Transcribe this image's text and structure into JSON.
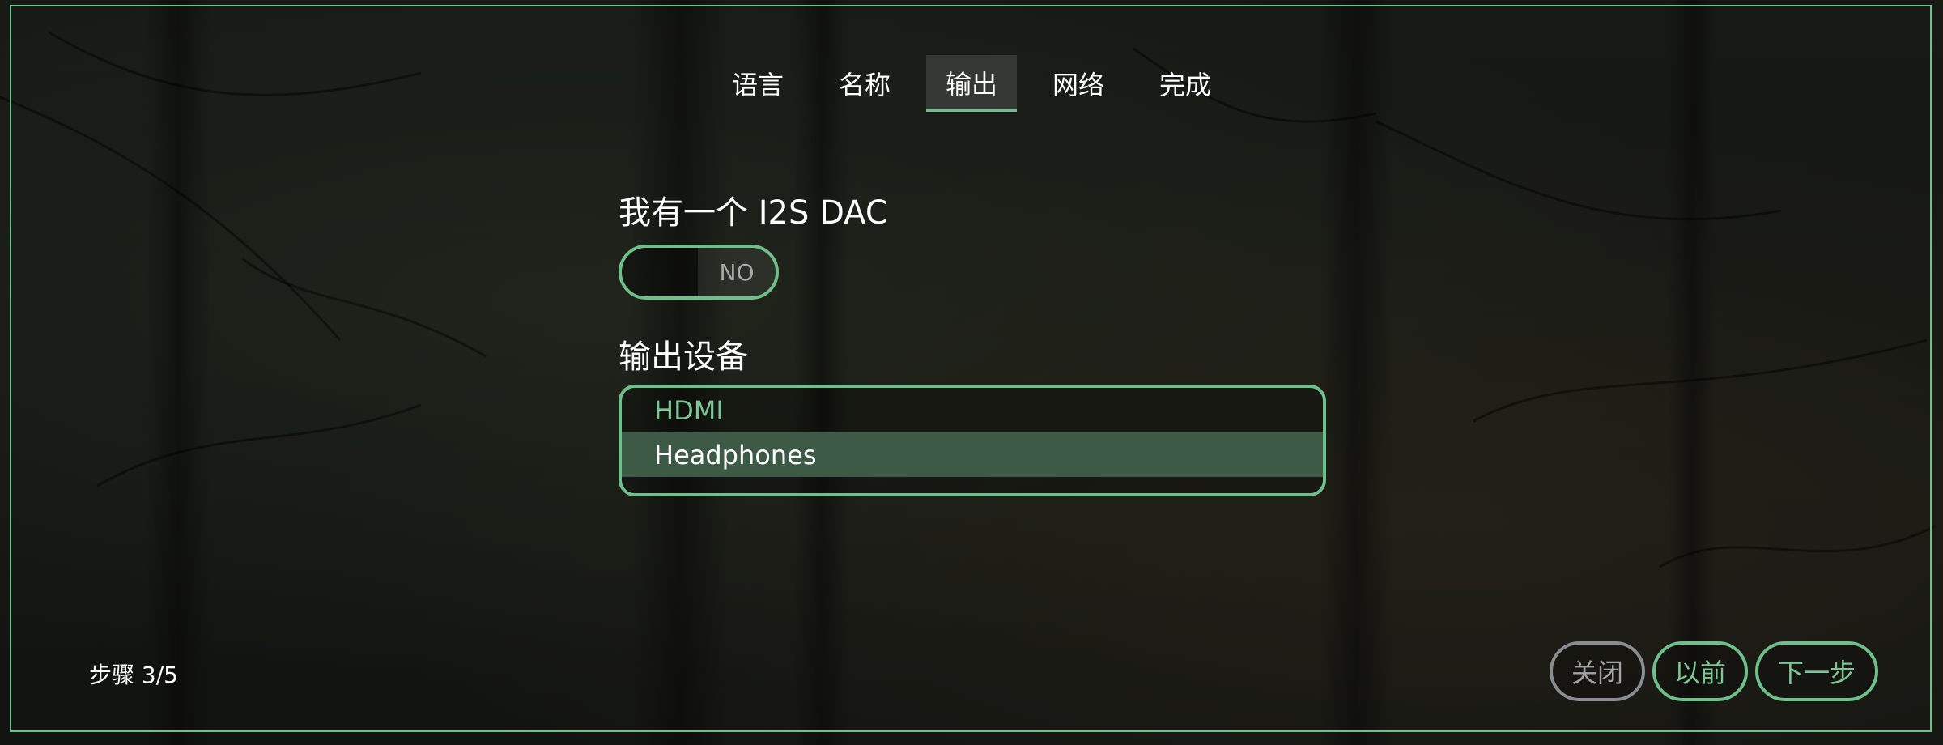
{
  "tabs": [
    {
      "label": "语言"
    },
    {
      "label": "名称"
    },
    {
      "label": "输出",
      "active": true
    },
    {
      "label": "网络"
    },
    {
      "label": "完成"
    }
  ],
  "dac": {
    "label": "我有一个 I2S DAC",
    "toggle_value": "NO"
  },
  "output": {
    "label": "输出设备",
    "options": [
      "HDMI",
      "Headphones"
    ],
    "selected": "Headphones"
  },
  "step_text": "步骤 3/5",
  "buttons": {
    "close": "关闭",
    "previous": "以前",
    "next": "下一步"
  },
  "colors": {
    "accent": "#6fbf8b",
    "selected_bg": "#3c5a45",
    "disabled_border": "#8a8d90"
  }
}
